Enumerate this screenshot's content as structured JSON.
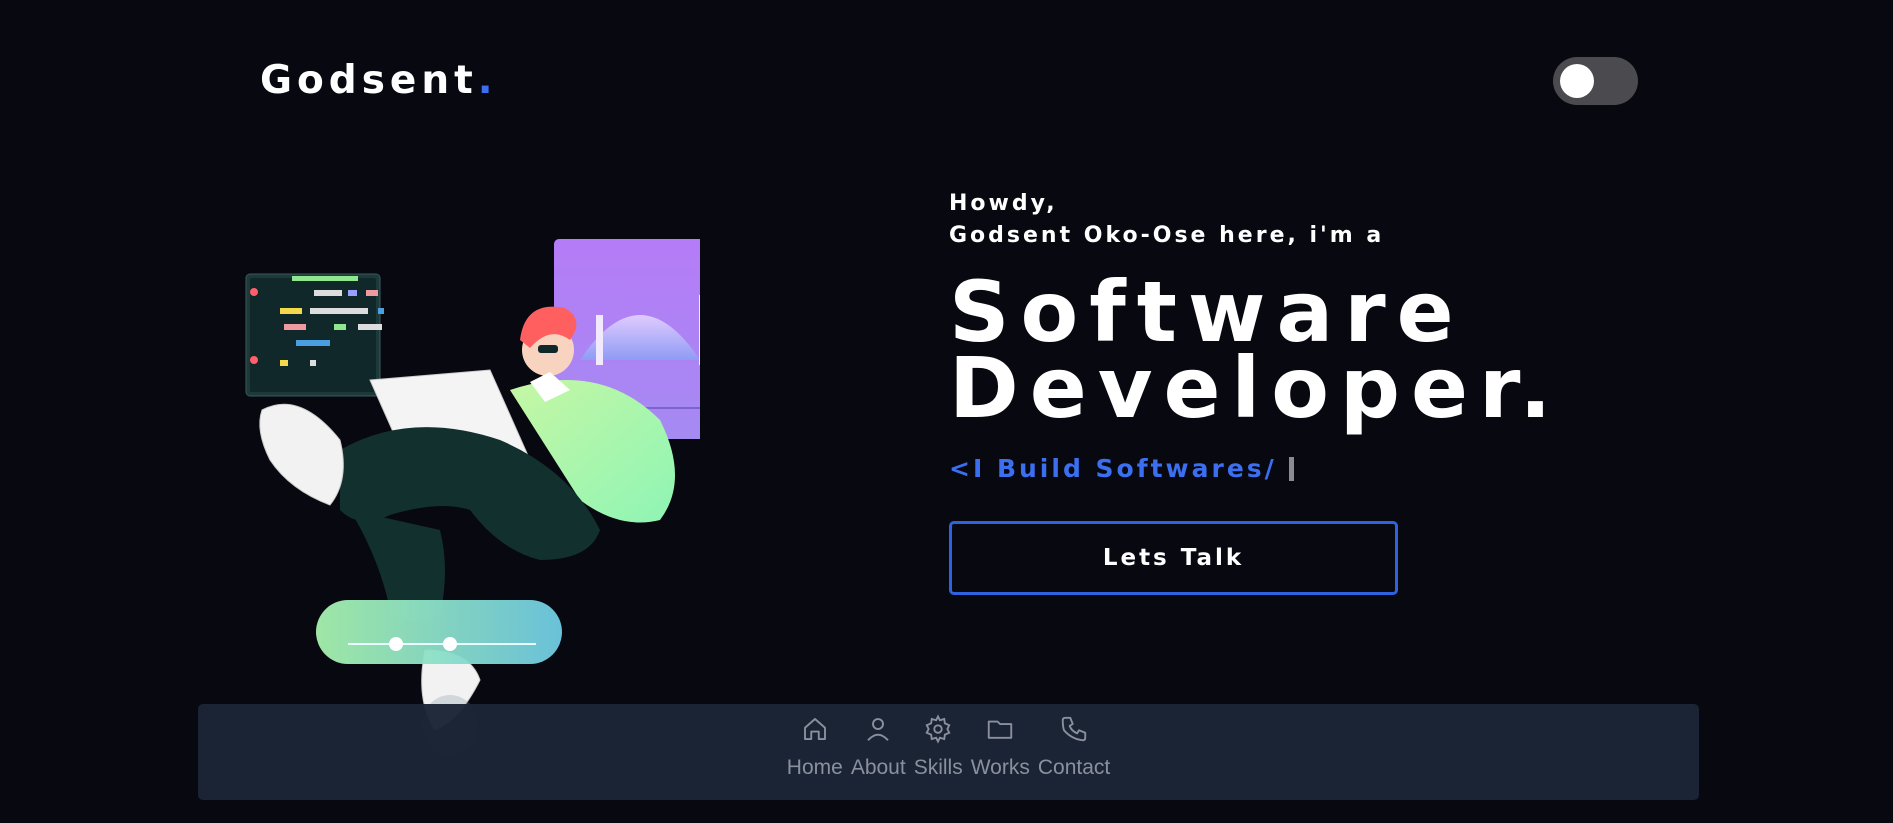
{
  "header": {
    "logo_text": "Godsent",
    "logo_dot": ".",
    "theme_toggle_state": "off"
  },
  "hero": {
    "greeting_line1": "Howdy,",
    "greeting_line2": "Godsent Oko-Ose here, i'm a",
    "headline_line1": "Software",
    "headline_line2": "Developer.",
    "tagline": "<I Build Softwares/",
    "cta_label": "Lets Talk"
  },
  "nav": {
    "items": [
      {
        "label": "Home",
        "icon": "home-icon"
      },
      {
        "label": "About",
        "icon": "user-icon"
      },
      {
        "label": "Skills",
        "icon": "gear-icon"
      },
      {
        "label": "Works",
        "icon": "folder-icon"
      },
      {
        "label": "Contact",
        "icon": "phone-icon"
      }
    ]
  },
  "colors": {
    "background": "#080810",
    "accent": "#3b6ff0",
    "nav_bg": "#1c2536",
    "nav_text": "#8f95a3",
    "toggle_track": "#4a4a4f"
  }
}
